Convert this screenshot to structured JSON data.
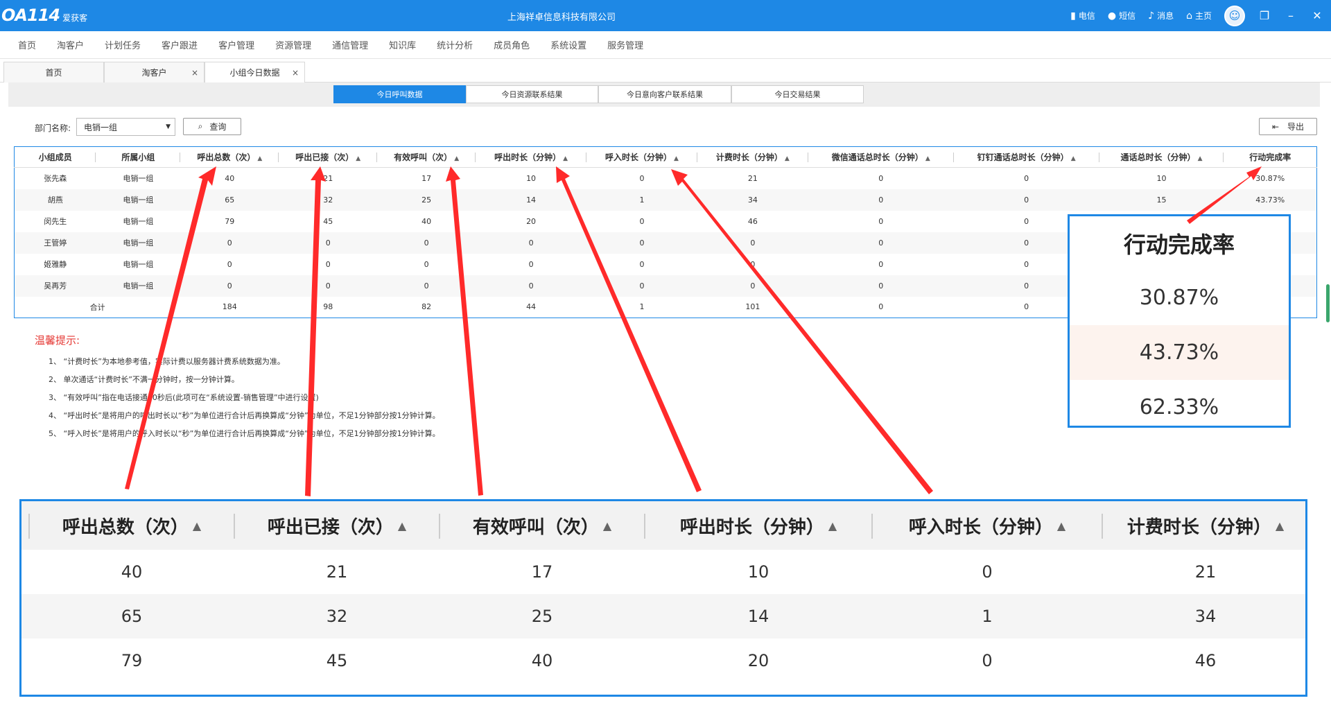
{
  "titlebar": {
    "logo_oa": "OA114",
    "logo_brand": "爱获客",
    "title": "上海祥卓信息科技有限公司",
    "carrier": "电信",
    "sms": "短信",
    "message": "消息",
    "home": "主页"
  },
  "menu": [
    "首页",
    "淘客户",
    "计划任务",
    "客户跟进",
    "客户管理",
    "资源管理",
    "通信管理",
    "知识库",
    "统计分析",
    "成员角色",
    "系统设置",
    "服务管理"
  ],
  "tabs": [
    {
      "label": "首页"
    },
    {
      "label": "淘客户",
      "close": "×"
    },
    {
      "label": "小组今日数据",
      "close": "×"
    }
  ],
  "subtabs": [
    "今日呼叫数据",
    "今日资源联系结果",
    "今日意向客户联系结果",
    "今日交易结果"
  ],
  "filter": {
    "label": "部门名称:",
    "selected": "电销一组",
    "query": "查询",
    "export": "导出"
  },
  "table": {
    "headers": [
      "小组成员",
      "所属小组",
      "呼出总数（次）",
      "呼出已接（次）",
      "有效呼叫（次）",
      "呼出时长（分钟）",
      "呼入时长（分钟）",
      "计费时长（分钟）",
      "微信通话总时长（分钟）",
      "钉钉通话总时长（分钟）",
      "通话总时长（分钟）",
      "行动完成率"
    ],
    "rows": [
      [
        "张先森",
        "电销一组",
        "40",
        "21",
        "17",
        "10",
        "0",
        "21",
        "0",
        "0",
        "10",
        "30.87%"
      ],
      [
        "胡燕",
        "电销一组",
        "65",
        "32",
        "25",
        "14",
        "1",
        "34",
        "0",
        "0",
        "15",
        "43.73%"
      ],
      [
        "闵先生",
        "电销一组",
        "79",
        "45",
        "40",
        "20",
        "0",
        "46",
        "0",
        "0",
        "",
        ""
      ],
      [
        "王管婷",
        "电销一组",
        "0",
        "0",
        "0",
        "0",
        "0",
        "0",
        "0",
        "0",
        "",
        ""
      ],
      [
        "姬雅静",
        "电销一组",
        "0",
        "0",
        "0",
        "0",
        "0",
        "0",
        "0",
        "0",
        "",
        ""
      ],
      [
        "吴再芳",
        "电销一组",
        "0",
        "0",
        "0",
        "0",
        "0",
        "0",
        "0",
        "0",
        "",
        ""
      ]
    ],
    "total": [
      "合计",
      "184",
      "98",
      "82",
      "44",
      "1",
      "101",
      "0",
      "0"
    ]
  },
  "tips": {
    "title": "温馨提示:",
    "items": [
      "1、 “计费时长”为本地参考值，实际计费以服务器计费系统数据为准。",
      "2、  单次通话“计费时长”不满一分钟时，按一分钟计算。",
      "3、 “有效呼叫”指在电话接通10秒后(此项可在“系统设置-销售管理”中进行设置)",
      "4、 “呼出时长”是将用户的呼出时长以“秒”为单位进行合计后再换算成“分钟”为单位，不足1分钟部分按1分钟计算。",
      "5、 “呼入时长”是将用户的呼入时长以“秒”为单位进行合计后再换算成“分钟”为单位，不足1分钟部分按1分钟计算。"
    ]
  },
  "zoom_right": {
    "header": "行动完成率",
    "values": [
      "30.87%",
      "43.73%",
      "62.33%"
    ]
  },
  "zoom_bottom": {
    "headers": [
      "呼出总数（次）",
      "呼出已接（次）",
      "有效呼叫（次）",
      "呼出时长（分钟）",
      "呼入时长（分钟）",
      "计费时长（分钟）"
    ],
    "rows": [
      [
        "40",
        "21",
        "17",
        "10",
        "0",
        "21"
      ],
      [
        "65",
        "32",
        "25",
        "14",
        "1",
        "34"
      ],
      [
        "79",
        "45",
        "40",
        "20",
        "0",
        "46"
      ]
    ]
  },
  "colors": {
    "brand": "#1e88e5",
    "annotation": "#ff2a2a",
    "tip": "#e53935"
  }
}
